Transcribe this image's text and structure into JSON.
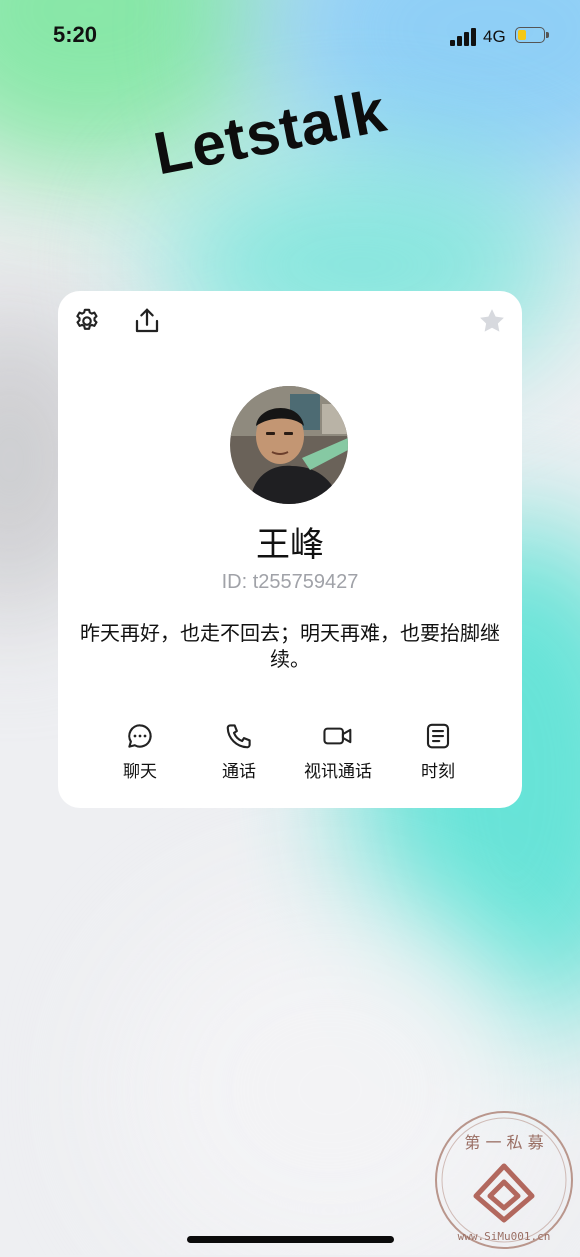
{
  "status_bar": {
    "time": "5:20",
    "network": "4G",
    "battery_level": 0.3
  },
  "brand": {
    "title": "Letstalk"
  },
  "card": {
    "settings_icon": "gear-icon",
    "share_icon": "share-icon",
    "favorite_icon": "star-icon",
    "name": "王峰",
    "id_text": "ID: t255759427",
    "bio": "昨天再好，也走不回去；明天再难，也要抬脚继续。",
    "actions": [
      {
        "label": "聊天",
        "icon": "chat-icon"
      },
      {
        "label": "通话",
        "icon": "phone-icon"
      },
      {
        "label": "视讯通话",
        "icon": "video-icon"
      },
      {
        "label": "时刻",
        "icon": "moments-icon"
      }
    ]
  },
  "watermark": {
    "text": "第一私募 www.SiMu001.cn"
  },
  "colors": {
    "favorite_star": "#d7d9de",
    "id_text": "#a0a2a8",
    "battery": "#f5c814"
  }
}
